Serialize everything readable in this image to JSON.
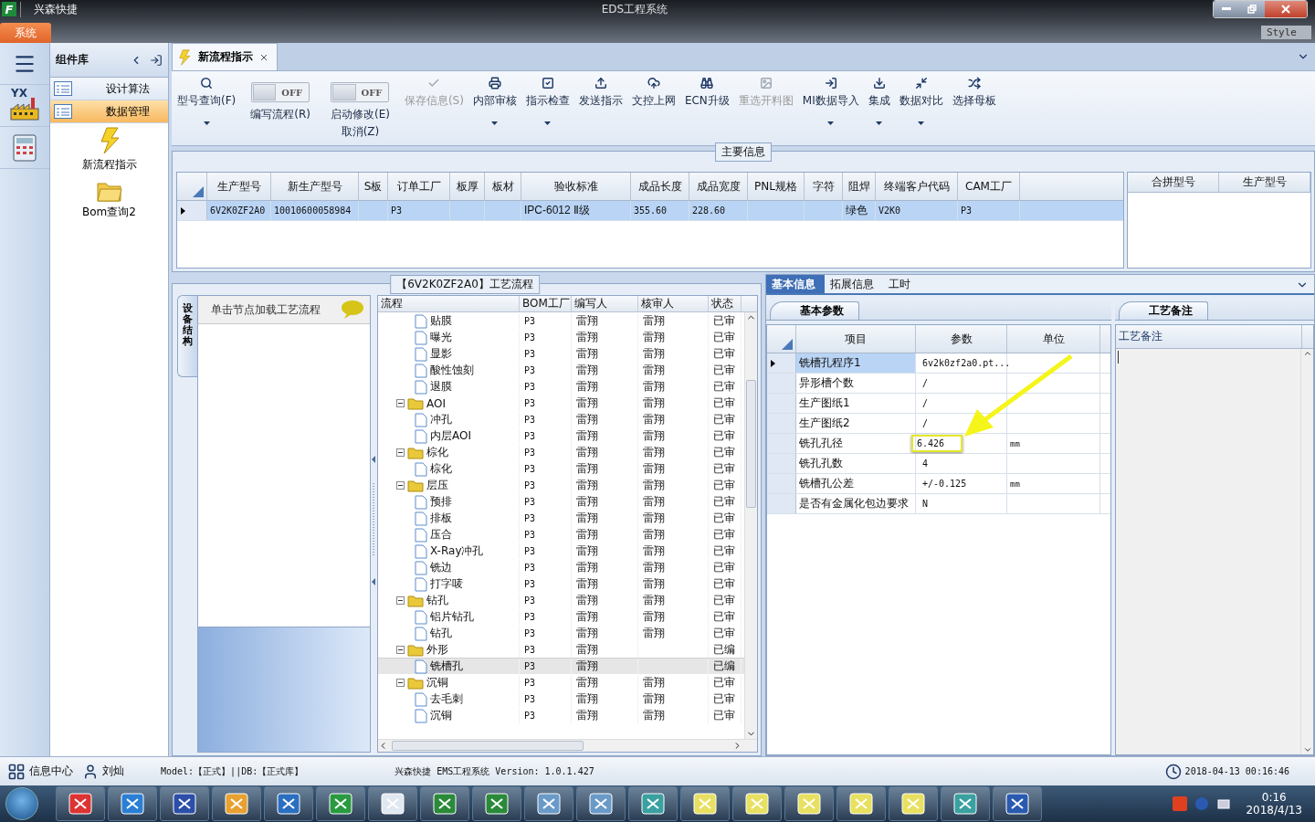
{
  "window": {
    "app_letter": "F",
    "app_name": "兴森快捷",
    "title": "EDS工程系统",
    "menu_tab": "系统",
    "style_label": "Style"
  },
  "rail": {
    "logo_text": "YX"
  },
  "component_library": {
    "title": "组件库",
    "items": [
      {
        "label": "设计算法",
        "selected": false
      },
      {
        "label": "数据管理",
        "selected": true
      }
    ],
    "tools": [
      {
        "label": "新流程指示"
      },
      {
        "label": "Bom查询2"
      }
    ]
  },
  "doc_tabs": [
    {
      "label": "新流程指示",
      "selected": true
    }
  ],
  "toolbar": [
    {
      "kind": "button",
      "label": "型号查询(F)",
      "dropdown": true,
      "disabled": false
    },
    {
      "kind": "toggle",
      "label": "编写流程(R)",
      "on": false,
      "switch_text": "OFF"
    },
    {
      "kind": "toggle",
      "label": "启动修改(E)",
      "label2": "取消(Z)",
      "on": false,
      "switch_text": "OFF"
    },
    {
      "kind": "button",
      "label": "保存信息(S)",
      "dropdown": false,
      "disabled": true
    },
    {
      "kind": "button",
      "label": "内部审核",
      "dropdown": true,
      "disabled": false
    },
    {
      "kind": "button",
      "label": "指示检查",
      "dropdown": true,
      "disabled": false
    },
    {
      "kind": "button",
      "label": "发送指示",
      "dropdown": false,
      "disabled": false
    },
    {
      "kind": "button",
      "label": "文控上网",
      "dropdown": false,
      "disabled": false
    },
    {
      "kind": "button",
      "label": "ECN升级",
      "dropdown": false,
      "disabled": false
    },
    {
      "kind": "button",
      "label": "重选开料图",
      "dropdown": false,
      "disabled": true
    },
    {
      "kind": "button",
      "label": "MI数据导入",
      "dropdown": true,
      "disabled": false
    },
    {
      "kind": "button",
      "label": "集成",
      "dropdown": true,
      "disabled": false
    },
    {
      "kind": "button",
      "label": "数据对比",
      "dropdown": true,
      "disabled": false
    },
    {
      "kind": "button",
      "label": "选择母板",
      "dropdown": false,
      "disabled": false
    }
  ],
  "main_info": {
    "title": "主要信息",
    "columns": [
      "生产型号",
      "新生产型号",
      "S板",
      "订单工厂",
      "板厚",
      "板材",
      "验收标准",
      "成品长度",
      "成品宽度",
      "PNL规格",
      "字符",
      "阻焊",
      "终端客户代码",
      "CAM工厂"
    ],
    "rows": [
      {
        "selected": true,
        "cells": [
          "6V2K0ZF2A0",
          "10010600058984",
          null,
          "P3",
          null,
          null,
          "IPC-6012 Ⅱ级",
          "355.60",
          "228.60",
          null,
          null,
          "绿色",
          "V2K0",
          "P3"
        ]
      }
    ],
    "side_columns": [
      "合拼型号",
      "生产型号"
    ]
  },
  "process": {
    "title": "【6V2K0ZF2A0】工艺流程",
    "side_tab": "设备结构",
    "node_hint": "单击节点加载工艺流程",
    "columns": [
      "流程",
      "BOM工厂",
      "编写人",
      "核审人",
      "状态"
    ],
    "tree": [
      {
        "children": [
          {
            "label": "贴膜",
            "bom": "P3",
            "writer": "雷翔",
            "reviewer": "雷翔",
            "status": "已审",
            "selected": false
          },
          {
            "label": "曝光",
            "bom": "P3",
            "writer": "雷翔",
            "reviewer": "雷翔",
            "status": "已审",
            "selected": false
          },
          {
            "label": "显影",
            "bom": "P3",
            "writer": "雷翔",
            "reviewer": "雷翔",
            "status": "已审",
            "selected": false
          },
          {
            "label": "酸性蚀刻",
            "bom": "P3",
            "writer": "雷翔",
            "reviewer": "雷翔",
            "status": "已审",
            "selected": false
          },
          {
            "label": "退膜",
            "bom": "P3",
            "writer": "雷翔",
            "reviewer": "雷翔",
            "status": "已审",
            "selected": false
          }
        ]
      },
      {
        "label": "AOI",
        "bom": "P3",
        "writer": "雷翔",
        "reviewer": "雷翔",
        "status": "已审",
        "selected": false,
        "expanded": true,
        "children": [
          {
            "label": "冲孔",
            "bom": "P3",
            "writer": "雷翔",
            "reviewer": "雷翔",
            "status": "已审",
            "selected": false
          },
          {
            "label": "内层AOI",
            "bom": "P3",
            "writer": "雷翔",
            "reviewer": "雷翔",
            "status": "已审",
            "selected": false
          }
        ]
      },
      {
        "label": "棕化",
        "bom": "P3",
        "writer": "雷翔",
        "reviewer": "雷翔",
        "status": "已审",
        "selected": false,
        "expanded": true,
        "children": [
          {
            "label": "棕化",
            "bom": "P3",
            "writer": "雷翔",
            "reviewer": "雷翔",
            "status": "已审",
            "selected": false
          }
        ]
      },
      {
        "label": "层压",
        "bom": "P3",
        "writer": "雷翔",
        "reviewer": "雷翔",
        "status": "已审",
        "selected": false,
        "expanded": true,
        "children": [
          {
            "label": "预排",
            "bom": "P3",
            "writer": "雷翔",
            "reviewer": "雷翔",
            "status": "已审",
            "selected": false
          },
          {
            "label": "排板",
            "bom": "P3",
            "writer": "雷翔",
            "reviewer": "雷翔",
            "status": "已审",
            "selected": false
          },
          {
            "label": "压合",
            "bom": "P3",
            "writer": "雷翔",
            "reviewer": "雷翔",
            "status": "已审",
            "selected": false
          },
          {
            "label": "X-Ray冲孔",
            "bom": "P3",
            "writer": "雷翔",
            "reviewer": "雷翔",
            "status": "已审",
            "selected": false
          },
          {
            "label": "铣边",
            "bom": "P3",
            "writer": "雷翔",
            "reviewer": "雷翔",
            "status": "已审",
            "selected": false
          },
          {
            "label": "打字唛",
            "bom": "P3",
            "writer": "雷翔",
            "reviewer": "雷翔",
            "status": "已审",
            "selected": false
          }
        ]
      },
      {
        "label": "钻孔",
        "bom": "P3",
        "writer": "雷翔",
        "reviewer": "雷翔",
        "status": "已审",
        "selected": false,
        "expanded": true,
        "children": [
          {
            "label": "铝片钻孔",
            "bom": "P3",
            "writer": "雷翔",
            "reviewer": "雷翔",
            "status": "已审",
            "selected": false
          },
          {
            "label": "钻孔",
            "bom": "P3",
            "writer": "雷翔",
            "reviewer": "雷翔",
            "status": "已审",
            "selected": false
          }
        ]
      },
      {
        "label": "外形",
        "bom": "P3",
        "writer": "雷翔",
        "status": "已编",
        "selected": false,
        "expanded": true,
        "children": [
          {
            "label": "铣槽孔",
            "bom": "P3",
            "writer": "雷翔",
            "status": "已编",
            "selected": true
          }
        ]
      },
      {
        "label": "沉铜",
        "bom": "P3",
        "writer": "雷翔",
        "reviewer": "雷翔",
        "status": "已审",
        "selected": false,
        "expanded": true,
        "children": [
          {
            "label": "去毛刺",
            "bom": "P3",
            "writer": "雷翔",
            "reviewer": "雷翔",
            "status": "已审",
            "selected": false
          },
          {
            "label": "沉铜",
            "bom": "P3",
            "writer": "雷翔",
            "reviewer": "雷翔",
            "status": "已审",
            "selected": false
          }
        ]
      }
    ]
  },
  "detail": {
    "tabs": [
      {
        "label": "基本信息",
        "selected": true
      },
      {
        "label": "拓展信息",
        "selected": false
      },
      {
        "label": "工时",
        "selected": false
      }
    ],
    "params_tab": "基本参数",
    "columns": [
      "项目",
      "参数",
      "单位"
    ],
    "rows": [
      {
        "item": "铣槽孔程序1",
        "value": "6v2k0zf2a0.pt...",
        "selected": true,
        "highlighted": false
      },
      {
        "item": "异形槽个数",
        "value": "/",
        "selected": false,
        "highlighted": false
      },
      {
        "item": "生产图纸1",
        "value": "/",
        "selected": false,
        "highlighted": false
      },
      {
        "item": "生产图纸2",
        "value": "/",
        "selected": false,
        "highlighted": false
      },
      {
        "item": "铣孔孔径",
        "value": "6.426",
        "unit": "mm",
        "selected": false,
        "highlighted": true
      },
      {
        "item": "铣孔孔数",
        "value": "4",
        "selected": false,
        "highlighted": false
      },
      {
        "item": "铣槽孔公差",
        "value": "+/-0.125",
        "unit": "mm",
        "selected": false,
        "highlighted": false
      },
      {
        "item": "是否有金属化包边要求",
        "value": "N",
        "selected": false,
        "highlighted": false
      }
    ],
    "notes_tab": "工艺备注",
    "notes_column": "工艺备注"
  },
  "status_bar": {
    "info_center": "信息中心",
    "user": "刘灿",
    "model": "Model:【正式】||DB:【正式库】",
    "product": "兴森快捷 EMS工程系统 Version: 1.0.1.427",
    "datetime": "2018-04-13 00:16:46"
  },
  "taskbar": {
    "time": "0:16",
    "date": "2018/4/13"
  }
}
